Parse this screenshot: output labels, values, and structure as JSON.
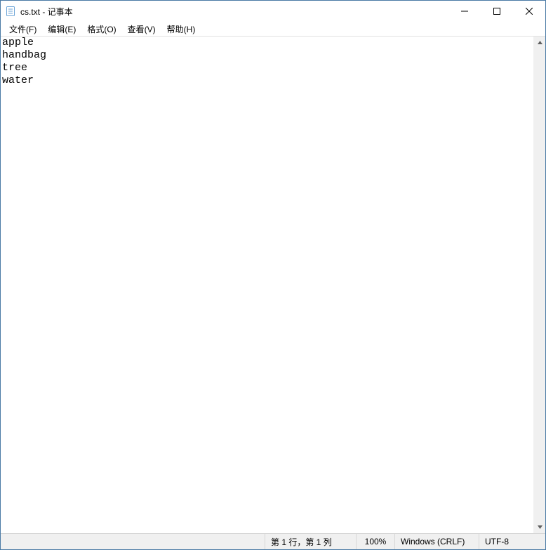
{
  "window": {
    "title": "cs.txt - 记事本"
  },
  "menus": {
    "file": "文件(F)",
    "edit": "编辑(E)",
    "format": "格式(O)",
    "view": "查看(V)",
    "help": "帮助(H)"
  },
  "editor": {
    "content": "apple\nhandbag\ntree\nwater"
  },
  "status": {
    "cursor": "第 1 行，第 1 列",
    "zoom": "100%",
    "line_end": "Windows (CRLF)",
    "encoding": "UTF-8"
  }
}
